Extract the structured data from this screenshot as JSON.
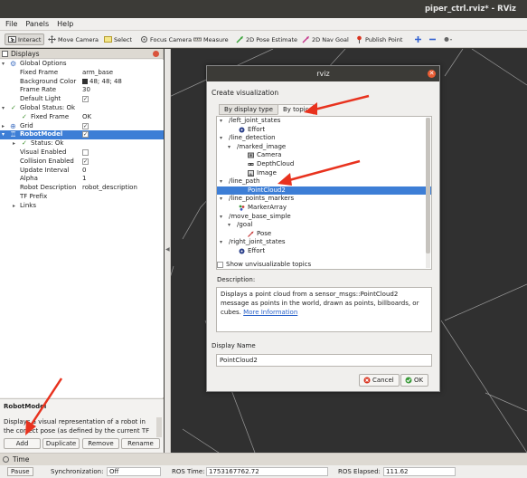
{
  "window": {
    "title": "piper_ctrl.rviz* - RViz"
  },
  "menu": [
    "File",
    "Panels",
    "Help"
  ],
  "toolbar": [
    {
      "label": "Interact",
      "icon": "interact-icon",
      "active": true
    },
    {
      "label": "Move Camera",
      "icon": "move-camera-icon"
    },
    {
      "label": "Select",
      "icon": "select-icon"
    },
    {
      "label": "Focus Camera",
      "icon": "focus-camera-icon"
    },
    {
      "label": "Measure",
      "icon": "measure-icon"
    },
    {
      "label": "2D Pose Estimate",
      "icon": "pose-estimate-icon"
    },
    {
      "label": "2D Nav Goal",
      "icon": "nav-goal-icon"
    },
    {
      "label": "Publish Point",
      "icon": "publish-point-icon"
    }
  ],
  "displays": {
    "title": "Displays",
    "rows": {
      "global_options": "Global Options",
      "fixed_frame": "Fixed Frame",
      "fixed_frame_v": "arm_base",
      "background_color": "Background Color",
      "background_color_v": "48; 48; 48",
      "frame_rate": "Frame Rate",
      "frame_rate_v": "30",
      "default_light": "Default Light",
      "global_status": "Global Status: Ok",
      "fixed_frame_status": "Fixed Frame",
      "fixed_frame_status_v": "OK",
      "grid": "Grid",
      "robot_model": "RobotModel",
      "status_ok": "Status: Ok",
      "visual_enabled": "Visual Enabled",
      "collision_enabled": "Collision Enabled",
      "update_interval": "Update Interval",
      "update_interval_v": "0",
      "alpha": "Alpha",
      "alpha_v": "1",
      "robot_description": "Robot Description",
      "robot_description_v": "robot_description",
      "tf_prefix": "TF Prefix",
      "links": "Links"
    },
    "desc_title": "RobotModel",
    "desc_text": "Displays a visual representation of a robot in the correct pose (as defined by the current TF",
    "buttons": {
      "add": "Add",
      "duplicate": "Duplicate",
      "remove": "Remove",
      "rename": "Rename"
    }
  },
  "time": {
    "title": "Time",
    "pause": "Pause",
    "sync_label": "Synchronization:",
    "sync_value": "Off",
    "ros_time_label": "ROS Time:",
    "ros_time_value": "1753167762.72",
    "ros_elapsed_label": "ROS Elapsed:",
    "ros_elapsed_value": "111.62"
  },
  "dialog": {
    "title": "rviz",
    "create_label": "Create visualization",
    "tab_by_display": "By display type",
    "tab_by_topic": "By topic",
    "topics": {
      "left_joint_states": "/left_joint_states",
      "effort_1": "Effort",
      "line_detection": "/line_detection",
      "marked_image": "/marked_image",
      "camera": "Camera",
      "depthcloud": "DepthCloud",
      "image": "Image",
      "line_path": "/line_path",
      "pointcloud2": "PointCloud2",
      "line_points_markers": "/line_points_markers",
      "markerarray": "MarkerArray",
      "move_base_simple": "/move_base_simple",
      "goal": "/goal",
      "pose": "Pose",
      "right_joint_states": "/right_joint_states",
      "effort_2": "Effort"
    },
    "show_unvisualizable": "Show unvisualizable topics",
    "description_label": "Description:",
    "description_text": "Displays a point cloud from a sensor_msgs::PointCloud2 message as points in the world, drawn as points, billboards, or cubes.",
    "more_info": "More Information",
    "display_name_label": "Display Name",
    "display_name_value": "PointCloud2",
    "cancel": "Cancel",
    "ok": "OK"
  },
  "colors": {
    "selection": "#3d7ed6",
    "title_bar": "#3c3b37",
    "view_bg": "#303030",
    "annotation_arrow": "#e8321e"
  }
}
